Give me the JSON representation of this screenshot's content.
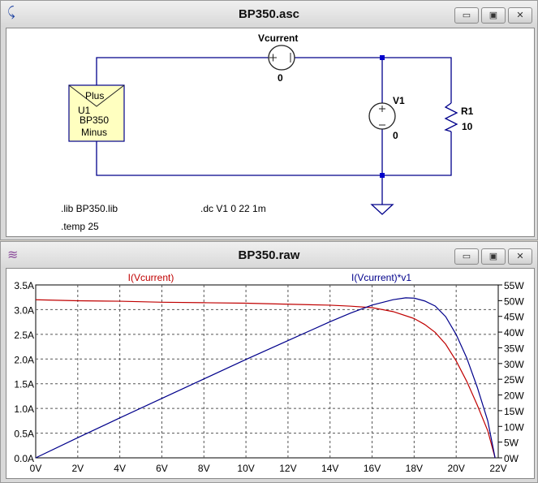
{
  "schematic_window": {
    "title": "BP350.asc",
    "icon": "schematic-icon",
    "buttons": {
      "minimize": "▭",
      "restore": "▣",
      "close": "✕"
    },
    "components": {
      "vcurrent": {
        "name": "Vcurrent",
        "value": "0"
      },
      "v1": {
        "name": "V1",
        "value": "0"
      },
      "r1": {
        "name": "R1",
        "value": "10"
      },
      "u1": {
        "pin_plus": "Plus",
        "name": "U1",
        "model": "BP350",
        "pin_minus": "Minus"
      }
    },
    "directives": {
      "lib": ".lib BP350.lib",
      "temp": ".temp 25",
      "dc": ".dc V1 0 22 1m"
    },
    "wire_color": "#00008b",
    "component_fill": "#ffffc0"
  },
  "waveform_window": {
    "title": "BP350.raw",
    "icon": "waveform-icon",
    "buttons": {
      "minimize": "▭",
      "restore": "▣",
      "close": "✕"
    }
  },
  "chart_data": {
    "type": "line",
    "xlabel": "",
    "xlim": [
      0,
      22
    ],
    "xticks": [
      "0V",
      "2V",
      "4V",
      "6V",
      "8V",
      "10V",
      "12V",
      "14V",
      "16V",
      "18V",
      "20V",
      "22V"
    ],
    "ylim_left": [
      0,
      3.5
    ],
    "yticks_left": [
      "0.0A",
      "0.5A",
      "1.0A",
      "1.5A",
      "2.0A",
      "2.5A",
      "3.0A",
      "3.5A"
    ],
    "ylim_right": [
      0,
      55
    ],
    "yticks_right": [
      "0W",
      "5W",
      "10W",
      "15W",
      "20W",
      "25W",
      "30W",
      "35W",
      "40W",
      "45W",
      "50W",
      "55W"
    ],
    "grid": true,
    "series": [
      {
        "name": "I(Vcurrent)",
        "axis": "left",
        "color": "#c00000",
        "x": [
          0,
          1,
          2,
          4,
          6,
          8,
          10,
          12,
          14,
          15,
          16,
          17,
          18,
          18.5,
          19,
          19.5,
          20,
          20.5,
          21,
          21.5,
          21.85
        ],
        "y": [
          3.2,
          3.19,
          3.18,
          3.17,
          3.15,
          3.14,
          3.13,
          3.11,
          3.09,
          3.07,
          3.04,
          2.96,
          2.82,
          2.7,
          2.54,
          2.3,
          1.96,
          1.55,
          1.07,
          0.55,
          0
        ]
      },
      {
        "name": "I(Vcurrent)*v1",
        "axis": "right",
        "color": "#00008b",
        "x": [
          0,
          2,
          4,
          6,
          8,
          10,
          12,
          14,
          15,
          16,
          17,
          17.6,
          18,
          18.5,
          19,
          19.5,
          20,
          20.5,
          21,
          21.5,
          21.85
        ],
        "y": [
          0,
          6.4,
          12.7,
          18.9,
          25.1,
          31.3,
          37.3,
          43.3,
          46.1,
          48.6,
          50.3,
          50.9,
          50.8,
          49.9,
          48.3,
          44.9,
          39.2,
          31.8,
          22.5,
          11.8,
          0
        ]
      }
    ]
  }
}
